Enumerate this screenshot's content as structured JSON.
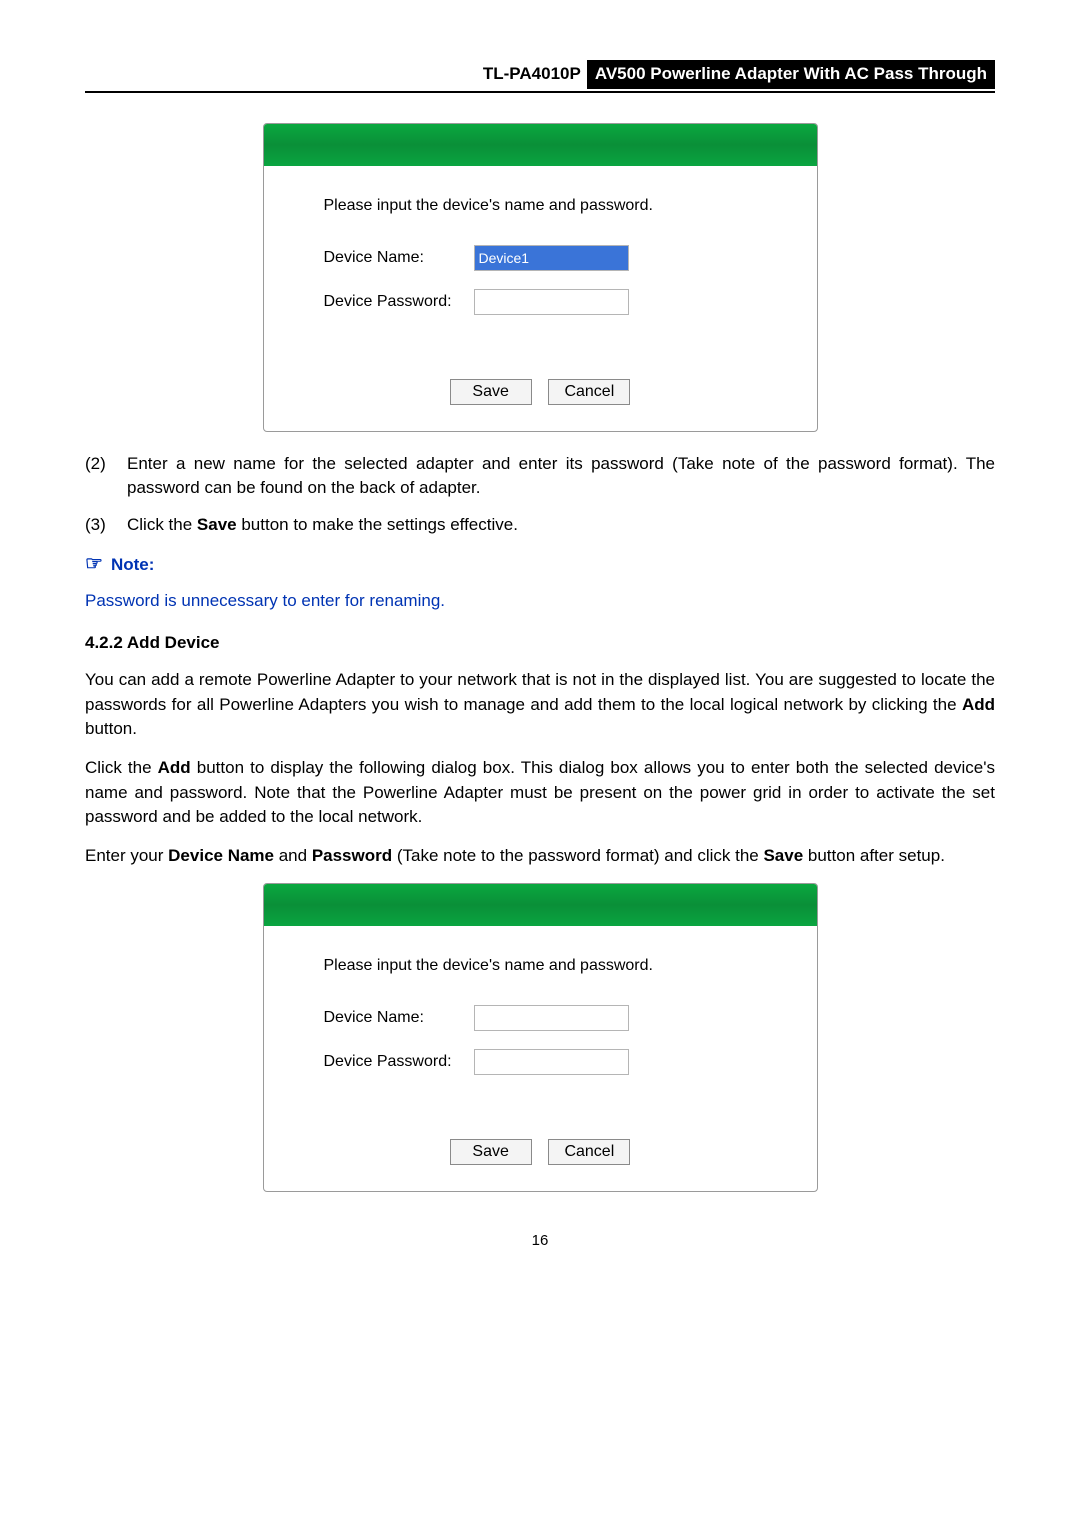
{
  "header": {
    "model": "TL-PA4010P",
    "title": "AV500 Powerline Adapter With AC Pass Through"
  },
  "dialog1": {
    "instruction": "Please input the device's name and password.",
    "labels": {
      "name": "Device Name:",
      "password": "Device Password:"
    },
    "values": {
      "name": "Device1",
      "password": ""
    },
    "buttons": {
      "save": "Save",
      "cancel": "Cancel"
    }
  },
  "steps": {
    "s2_marker": "(2)",
    "s2_text_a": "Enter a new name for the selected adapter and enter its password (Take note of the password format). The password can be found on the back of adapter.",
    "s3_marker": "(3)",
    "s3_text_a": "Click the ",
    "s3_bold": "Save",
    "s3_text_b": " button to make the settings effective."
  },
  "note": {
    "icon": "☞",
    "label": "Note:",
    "body": "Password is unnecessary to enter for renaming."
  },
  "section": {
    "heading": "4.2.2 Add Device",
    "p1_a": "You can add a remote Powerline Adapter to your network that is not in the displayed list. You are suggested to locate the passwords for all Powerline Adapters you wish to manage and add them to the local logical network by clicking the ",
    "p1_bold": "Add",
    "p1_b": " button.",
    "p2_a": "Click the ",
    "p2_bold": "Add",
    "p2_b": " button to display the following dialog box. This dialog box allows you to enter both the selected device's name and password. Note that the Powerline Adapter must be present on the power grid in order to activate the set password and be added to the local network.",
    "p3_a": "Enter your ",
    "p3_bold1": "Device Name",
    "p3_mid1": " and ",
    "p3_bold2": "Password",
    "p3_mid2": " (Take note to the password format) and click the ",
    "p3_bold3": "Save",
    "p3_b": " button after setup."
  },
  "dialog2": {
    "instruction": "Please input the device's name and password.",
    "labels": {
      "name": "Device Name:",
      "password": "Device Password:"
    },
    "values": {
      "name": "",
      "password": ""
    },
    "buttons": {
      "save": "Save",
      "cancel": "Cancel"
    }
  },
  "pageNumber": "16"
}
